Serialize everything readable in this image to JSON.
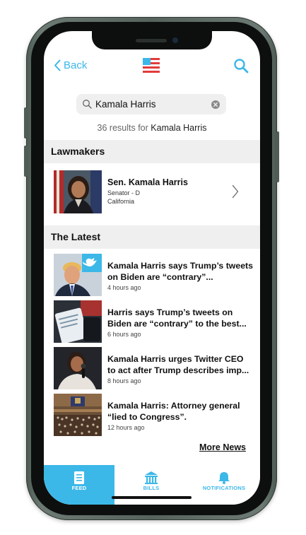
{
  "nav": {
    "back_label": "Back"
  },
  "search": {
    "value": "Kamala Harris",
    "placeholder": "Search"
  },
  "results": {
    "prefix": "36 results for",
    "query": "Kamala Harris"
  },
  "sections": {
    "lawmakers": "Lawmakers",
    "latest": "The Latest"
  },
  "lawmaker": {
    "name": "Sen. Kamala Harris",
    "role": "Senator - D",
    "state": "California"
  },
  "news": [
    {
      "headline": "Kamala Harris says Trump’s tweets on Biden are “contrary”...",
      "time": "4 hours ago"
    },
    {
      "headline": "Harris says Trump’s tweets on Biden are “contrary” to the best...",
      "time": "6 hours ago"
    },
    {
      "headline": "Kamala Harris urges Twitter CEO to act after Trump describes imp...",
      "time": "8 hours ago"
    },
    {
      "headline": "Kamala Harris: Attorney general “lied to Congress”.",
      "time": "12 hours ago"
    }
  ],
  "more_news_label": "More News",
  "tabs": [
    {
      "label": "FEED",
      "icon": "document-icon",
      "active": true
    },
    {
      "label": "BILLS",
      "icon": "capitol-building-icon",
      "active": false
    },
    {
      "label": "NOTIFICATIONS",
      "icon": "bell-icon",
      "active": false
    }
  ],
  "colors": {
    "accent": "#3cb8e8",
    "section_bg": "#efefef",
    "text": "#111111"
  }
}
